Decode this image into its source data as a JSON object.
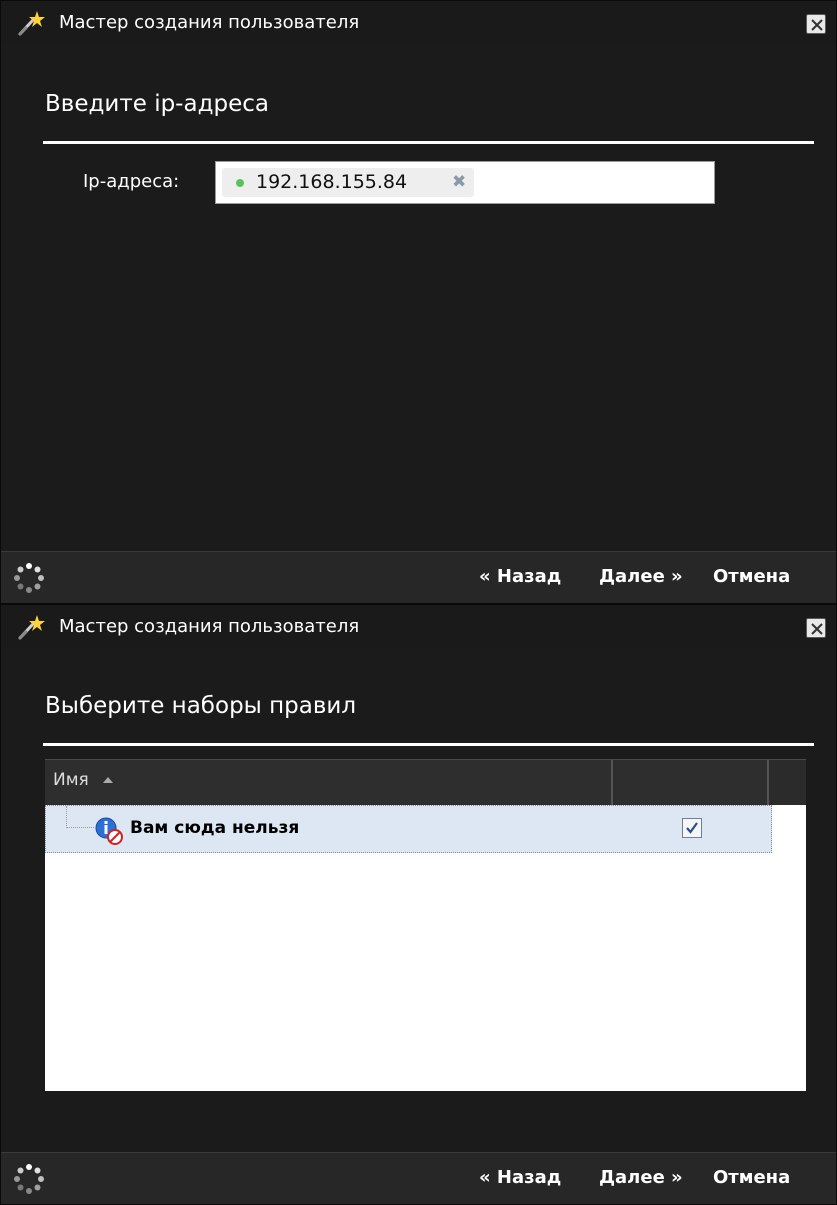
{
  "windows": [
    {
      "title": "Мастер создания пользователя",
      "heading": "Введите ip-адреса",
      "ip_field": {
        "label": "Ip-адреса:",
        "tokens": [
          {
            "value": "192.168.155.84",
            "remove": "✖"
          }
        ]
      },
      "footer": {
        "back": "« Назад",
        "next": "Далее »",
        "cancel": "Отмена"
      }
    },
    {
      "title": "Мастер создания пользователя",
      "heading": "Выберите наборы правил",
      "grid": {
        "columns": [
          {
            "label": "Имя"
          },
          {
            "label": ""
          }
        ],
        "rows": [
          {
            "name": "Вам сюда нельзя",
            "checked": true
          }
        ]
      },
      "footer": {
        "back": "« Назад",
        "next": "Далее »",
        "cancel": "Отмена"
      }
    }
  ],
  "icons": {
    "title": "magic-wand-icon",
    "close": "close-icon",
    "footer": "loading-spinner-icon",
    "rule": "rule-info-icon",
    "checkbox": "checkmark-icon"
  }
}
